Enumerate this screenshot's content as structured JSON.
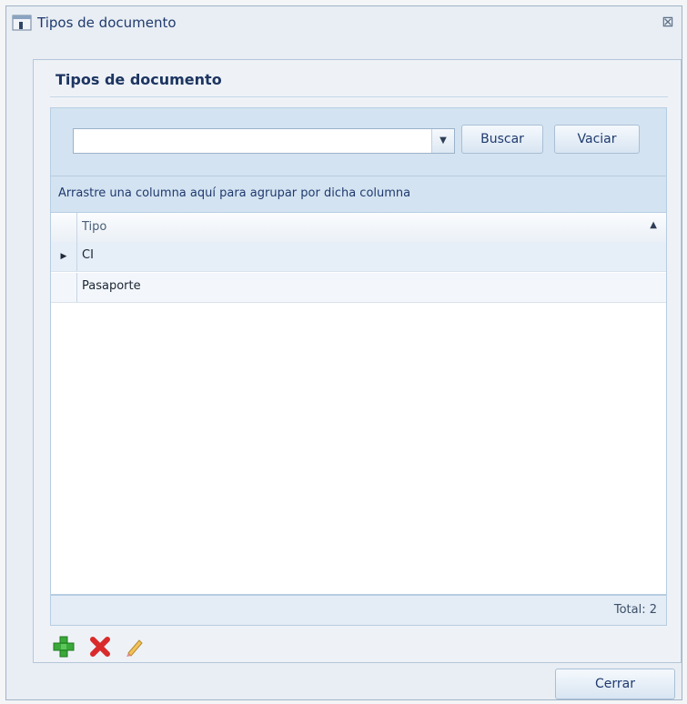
{
  "window": {
    "title": "Tipos de documento",
    "close_glyph": "⊠"
  },
  "group": {
    "title": "Tipos de documento"
  },
  "search": {
    "value": "",
    "placeholder": "",
    "buscar_label": "Buscar",
    "vaciar_label": "Vaciar"
  },
  "grid": {
    "group_hint": "Arrastre una columna aquí para agrupar por dicha columna",
    "columns": [
      {
        "label": "Tipo",
        "sort": "ascending"
      }
    ],
    "rows": [
      {
        "tipo": "CI",
        "selected": true
      },
      {
        "tipo": "Pasaporte",
        "selected": false
      }
    ],
    "total_label": "Total: 2"
  },
  "toolbar": {
    "add_icon": "add-icon",
    "delete_icon": "delete-icon",
    "edit_icon": "edit-pencil-icon"
  },
  "footer": {
    "cerrar_label": "Cerrar"
  },
  "colors": {
    "accent": "#1f3a6e",
    "panel": "#d4e3f1",
    "add": "#3aa83a",
    "delete": "#d92b2b"
  }
}
